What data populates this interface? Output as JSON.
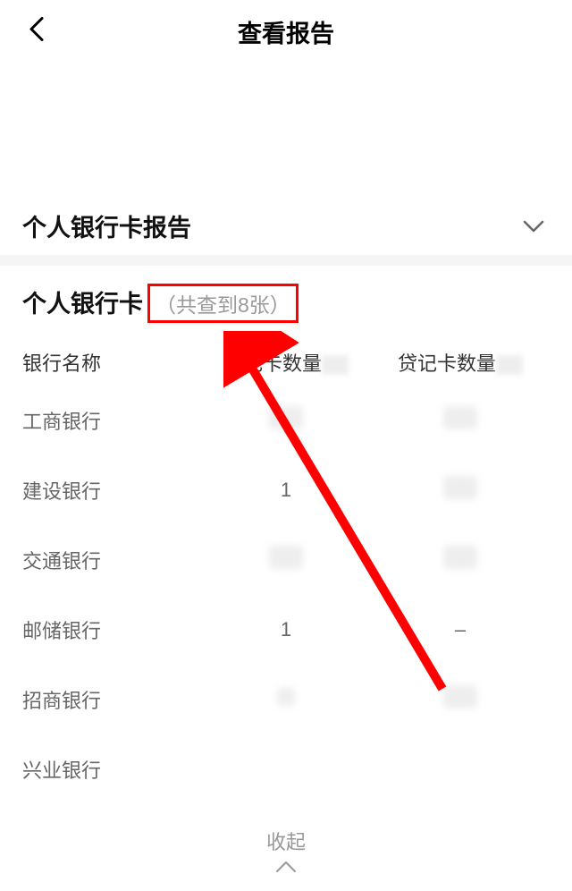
{
  "nav": {
    "title": "查看报告"
  },
  "section": {
    "title": "个人银行卡报告"
  },
  "card": {
    "title": "个人银行卡",
    "count_text": "（共查到8张）"
  },
  "table": {
    "headers": {
      "name": "银行名称",
      "debit": "借记卡数量",
      "credit": "贷记卡数量"
    },
    "rows": [
      {
        "name": "工商银行",
        "debit": "",
        "credit": ""
      },
      {
        "name": "建设银行",
        "debit": "1",
        "credit": ""
      },
      {
        "name": "交通银行",
        "debit": "",
        "credit": ""
      },
      {
        "name": "邮储银行",
        "debit": "1",
        "credit": "–"
      },
      {
        "name": "招商银行",
        "debit": "",
        "credit": ""
      },
      {
        "name": "兴业银行",
        "debit": "",
        "credit": ""
      }
    ]
  },
  "collapse": {
    "text": "收起"
  }
}
